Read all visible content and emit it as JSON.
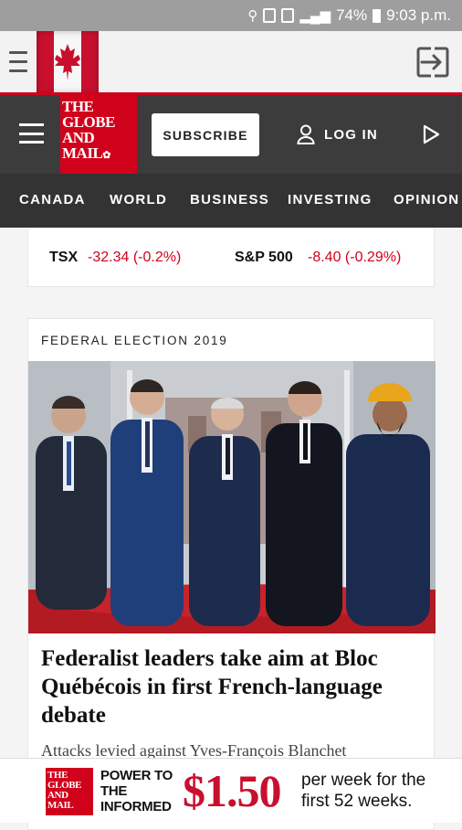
{
  "status_bar": {
    "battery": "74%",
    "time": "9:03 p.m."
  },
  "browser": {
    "menu_icon": "menu-icon",
    "flag_icon": "canadian-flag-icon",
    "exit_icon": "exit-icon"
  },
  "header": {
    "logo_lines": [
      "THE",
      "GLOBE",
      "AND",
      "MAIL"
    ],
    "subscribe_label": "SUBSCRIBE",
    "login_label": "LOG IN"
  },
  "nav": {
    "items": [
      "CANADA",
      "WORLD",
      "BUSINESS",
      "INVESTING",
      "OPINION"
    ]
  },
  "markets": [
    {
      "name": "TSX",
      "change": "-32.34 (-0.2%)"
    },
    {
      "name": "S&P 500",
      "change": "-8.40 (-0.29%)"
    }
  ],
  "story": {
    "kicker": "FEDERAL ELECTION 2019",
    "headline": "Federalist leaders take aim at Bloc Québécois in first French-language debate",
    "dek": "Attacks levied against Yves-François Blanchet"
  },
  "ad": {
    "logo_lines": [
      "THE",
      "GLOBE",
      "AND",
      "MAIL"
    ],
    "tagline": [
      "POWER TO",
      "THE",
      "INFORMED"
    ],
    "price": "$1.50",
    "terms": "per week for the first 52 weeks."
  },
  "colors": {
    "brand_red": "#d0021b",
    "header_dark": "#3c3c3c",
    "market_red": "#d0021b"
  }
}
